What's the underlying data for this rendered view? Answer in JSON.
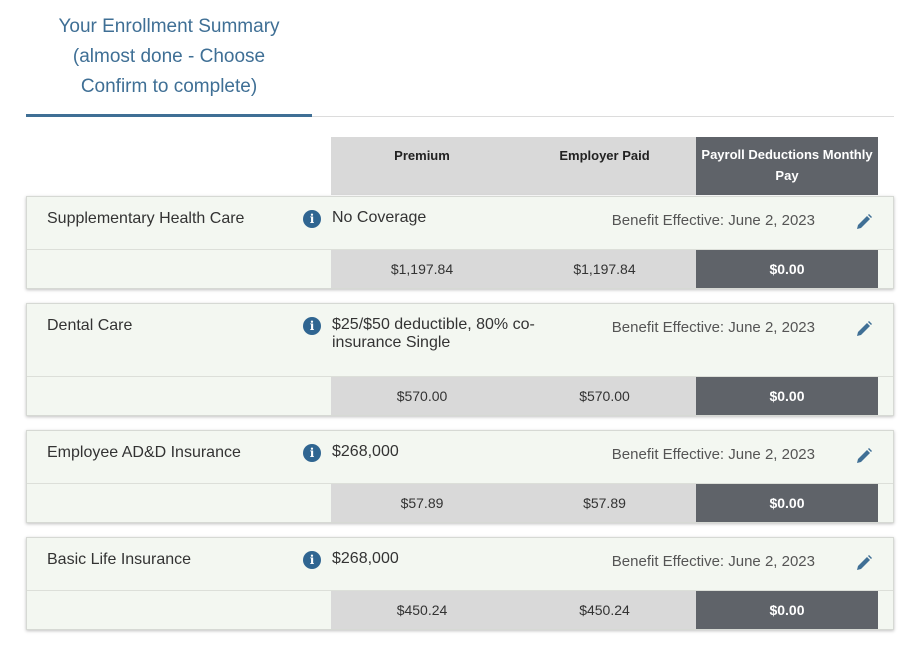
{
  "tab": {
    "lines": [
      "Your Enrollment Summary",
      "(almost done - Choose",
      "Confirm to complete)"
    ]
  },
  "columns": {
    "premium": "Premium",
    "employer_paid": "Employer Paid",
    "payroll": "Payroll Deductions Monthly Pay"
  },
  "benefits": [
    {
      "name": "Supplementary Health Care",
      "coverage": "No Coverage",
      "effective": "Benefit Effective: June 2, 2023",
      "premium": "$1,197.84",
      "employer_paid": "$1,197.84",
      "payroll": "$0.00"
    },
    {
      "name": "Dental Care",
      "coverage": "$25/$50 deductible, 80% co-insurance Single",
      "effective": "Benefit Effective: June 2, 2023",
      "premium": "$570.00",
      "employer_paid": "$570.00",
      "payroll": "$0.00"
    },
    {
      "name": "Employee AD&D Insurance",
      "coverage": "$268,000",
      "effective": "Benefit Effective: June 2, 2023",
      "premium": "$57.89",
      "employer_paid": "$57.89",
      "payroll": "$0.00"
    },
    {
      "name": "Basic Life Insurance",
      "coverage": "$268,000",
      "effective": "Benefit Effective: June 2, 2023",
      "premium": "$450.24",
      "employer_paid": "$450.24",
      "payroll": "$0.00"
    }
  ],
  "icons": {
    "info": "info-icon",
    "edit": "pencil-icon"
  },
  "colors": {
    "accent": "#3f6f95",
    "payroll_bg": "#5f6369",
    "row_bg": "#f3f7f1",
    "cell_bg": "#d9d9d9"
  }
}
